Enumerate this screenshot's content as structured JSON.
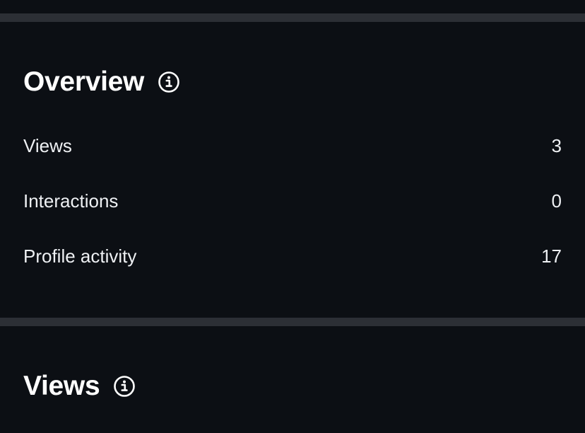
{
  "overview": {
    "title": "Overview",
    "info_icon": "info-circle-icon",
    "metrics": [
      {
        "label": "Views",
        "value": "3"
      },
      {
        "label": "Interactions",
        "value": "0"
      },
      {
        "label": "Profile activity",
        "value": "17"
      }
    ]
  },
  "views_section": {
    "title": "Views",
    "info_icon": "info-circle-icon"
  },
  "colors": {
    "background": "#0c0f14",
    "divider": "#2c2f35",
    "text": "#ffffff"
  }
}
